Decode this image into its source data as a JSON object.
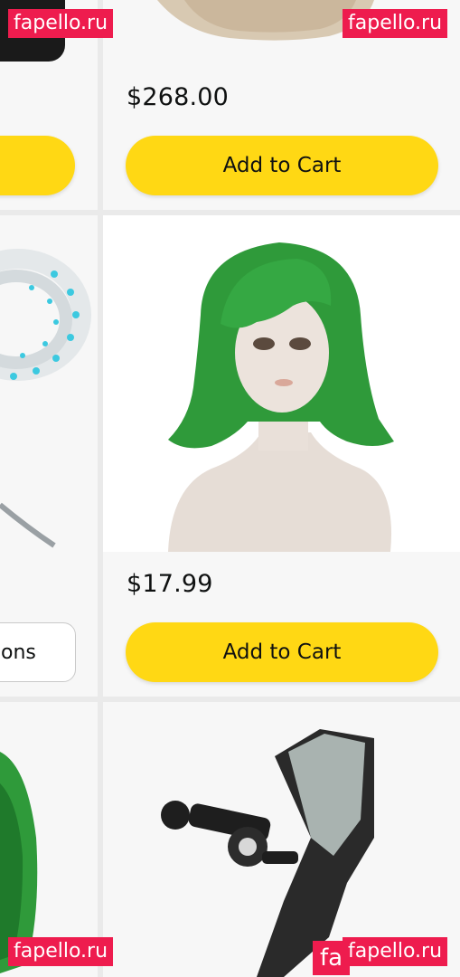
{
  "grid": {
    "row1": {
      "right": {
        "price": "$268.00",
        "button_label": "Add to Cart"
      }
    },
    "row2": {
      "left": {
        "partial_button_label": "ons",
        "image_icon": "led-strip-light-icon"
      },
      "right": {
        "price": "$17.99",
        "button_label": "Add to Cart",
        "image_icon": "green-wig-mannequin-icon"
      }
    },
    "row3": {
      "left": {
        "image_icon": "green-wig-icon"
      },
      "right": {
        "image_icon": "camera-mount-icon"
      }
    }
  },
  "watermarks": {
    "top_left": "fapello.ru",
    "top_right": "fapello.ru",
    "bottom_left": "fapello.ru",
    "bottom_right": "fapello.ru",
    "bottom_right_partial": "fa"
  },
  "colors": {
    "button_yellow": "#ffd814",
    "watermark_red": "#ee1c4e",
    "card_bg": "#f7f7f7",
    "wig_green": "#2f9a3a"
  }
}
